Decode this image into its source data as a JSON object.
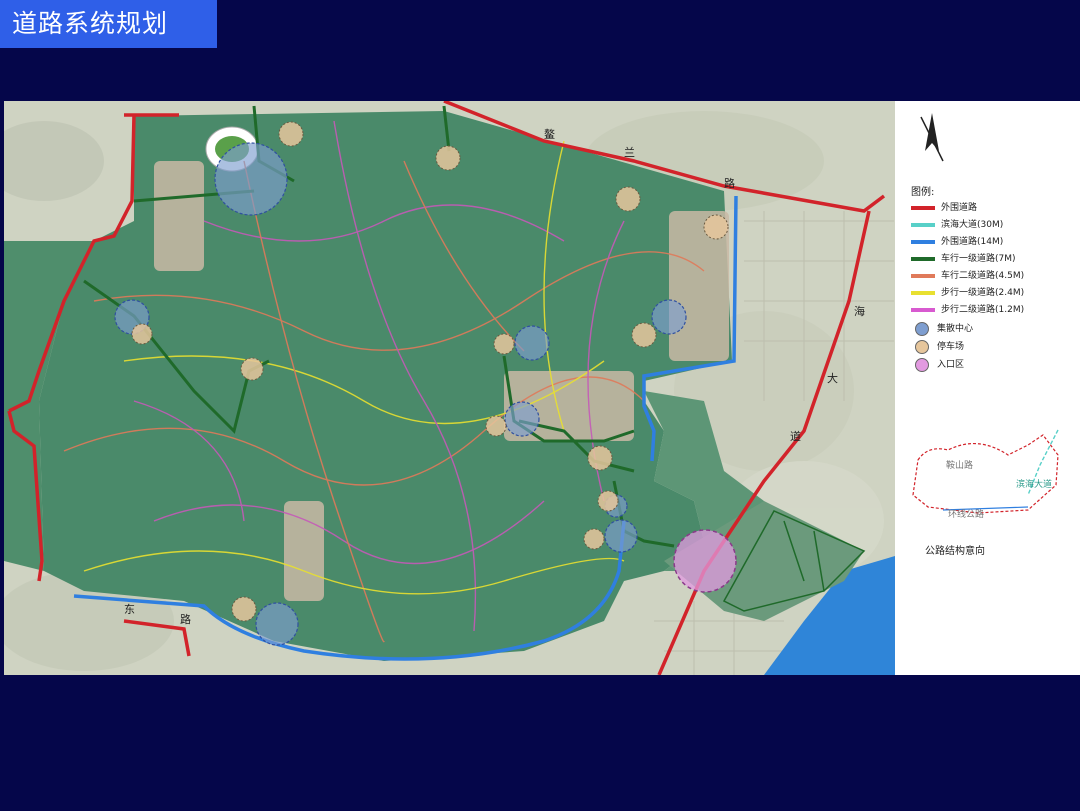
{
  "page_title": "道路系统规划",
  "map": {
    "road_labels": {
      "north_road": [
        "鳌",
        "兰",
        "路"
      ],
      "east_road": [
        "海",
        "大",
        "道"
      ],
      "south_road": [
        "东",
        "路"
      ]
    }
  },
  "legend": {
    "title": "图例:",
    "lines": [
      {
        "label": "外围道路",
        "color": "#d2232a"
      },
      {
        "label": "滨海大道(30M)",
        "color": "#58d0c8"
      },
      {
        "label": "外围道路(14M)",
        "color": "#2f7fe0"
      },
      {
        "label": "车行一级道路(7M)",
        "color": "#1f6a2a"
      },
      {
        "label": "车行二级道路(4.5M)",
        "color": "#e07a5a"
      },
      {
        "label": "步行一级道路(2.4M)",
        "color": "#e8e030"
      },
      {
        "label": "步行二级道路(1.2M)",
        "color": "#d85ad0"
      }
    ],
    "symbols": [
      {
        "label": "集散中心",
        "color": "#7e9ed0"
      },
      {
        "label": "停车场",
        "color": "#e6c69c"
      },
      {
        "label": "入口区",
        "color": "#e29ae0"
      }
    ]
  },
  "inset": {
    "labels": [
      "鞍山路",
      "滨海大道",
      "环线公路"
    ],
    "caption": "公路结构意向"
  }
}
